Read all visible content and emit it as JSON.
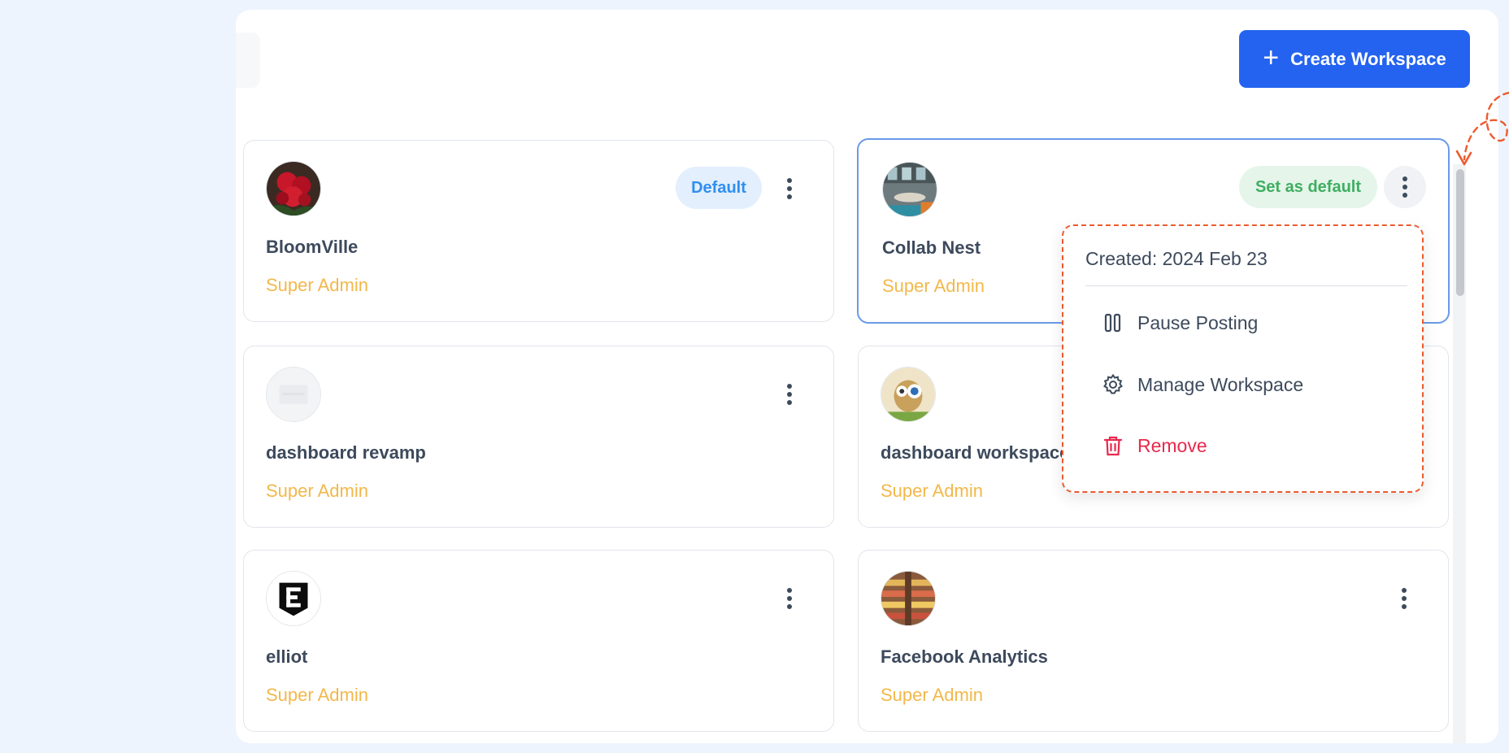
{
  "toolbar": {
    "create_label": "Create Workspace"
  },
  "workspaces": [
    {
      "name": "BloomVille",
      "role": "Super Admin",
      "badge": "Default",
      "avatar_icon": "roses-photo"
    },
    {
      "name": "Collab Nest",
      "role": "Super Admin",
      "badge": "Set as default",
      "avatar_icon": "office-photo"
    },
    {
      "name": "dashboard revamp",
      "role": "Super Admin",
      "avatar_icon": "placeholder-image"
    },
    {
      "name": "dashboard workspace",
      "role": "Super Admin",
      "avatar_icon": "cartoon-owl-photo"
    },
    {
      "name": "elliot",
      "role": "Super Admin",
      "avatar_icon": "e-shield-logo"
    },
    {
      "name": "Facebook Analytics",
      "role": "Super Admin",
      "avatar_icon": "grocery-store-photo"
    }
  ],
  "menu": {
    "created": "Created: 2024 Feb 23",
    "items": [
      {
        "label": "Pause Posting",
        "icon": "pause-icon"
      },
      {
        "label": "Manage Workspace",
        "icon": "gear-icon"
      },
      {
        "label": "Remove",
        "icon": "trash-icon"
      }
    ]
  },
  "colors": {
    "primary": "#2463f0",
    "role_text": "#f2b84b",
    "default_badge": "#2f8ef0",
    "set_default_badge": "#3fae60",
    "danger": "#e8294d",
    "annotation": "#ec5b2e"
  }
}
